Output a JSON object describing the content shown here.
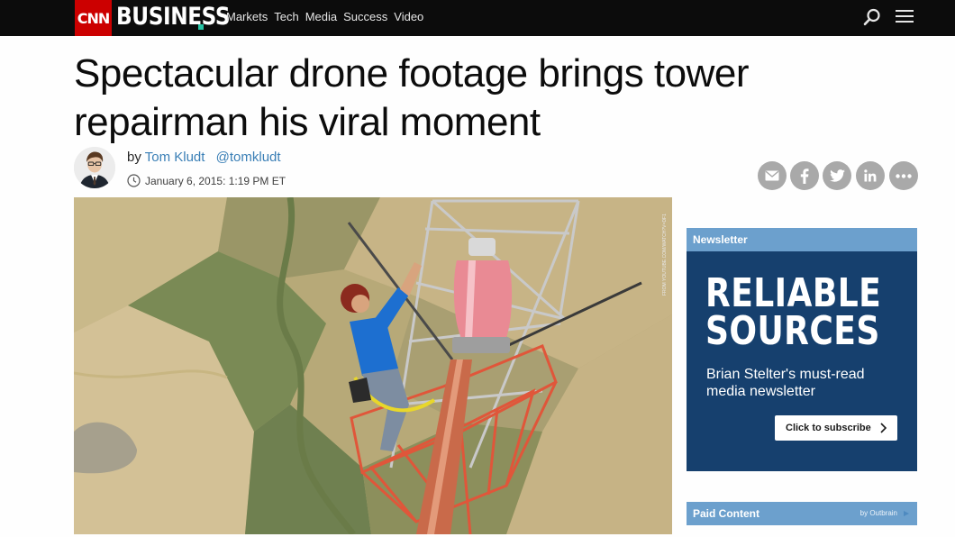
{
  "header": {
    "brand": "CNN",
    "section": "BUSINESS",
    "nav": [
      "Markets",
      "Tech",
      "Media",
      "Success",
      "Video"
    ]
  },
  "article": {
    "headline": "Spectacular drone footage brings tower repairman his viral moment",
    "byline_prefix": "by",
    "author": "Tom Kludt",
    "handle": "@tomkludt",
    "timestamp": "January 6, 2015: 1:19 PM ET",
    "image_credit": "FROM YOUTUBE.COM/WATCH?V=DF1"
  },
  "share": [
    "email-icon",
    "facebook-icon",
    "twitter-icon",
    "linkedin-icon",
    "more-icon"
  ],
  "sidebar": {
    "newsletter_label": "Newsletter",
    "promo_title_1": "RELIABLE",
    "promo_title_2": "SOURCES",
    "promo_desc": "Brian Stelter's must-read media newsletter",
    "cta": "Click to subscribe",
    "paid_label": "Paid Content",
    "paid_by": "by Outbrain"
  },
  "colors": {
    "cnn_red": "#cc0000",
    "link_blue": "#3a7fb6",
    "panel_blue": "#6ca0cd",
    "promo_navy": "#16406e"
  }
}
